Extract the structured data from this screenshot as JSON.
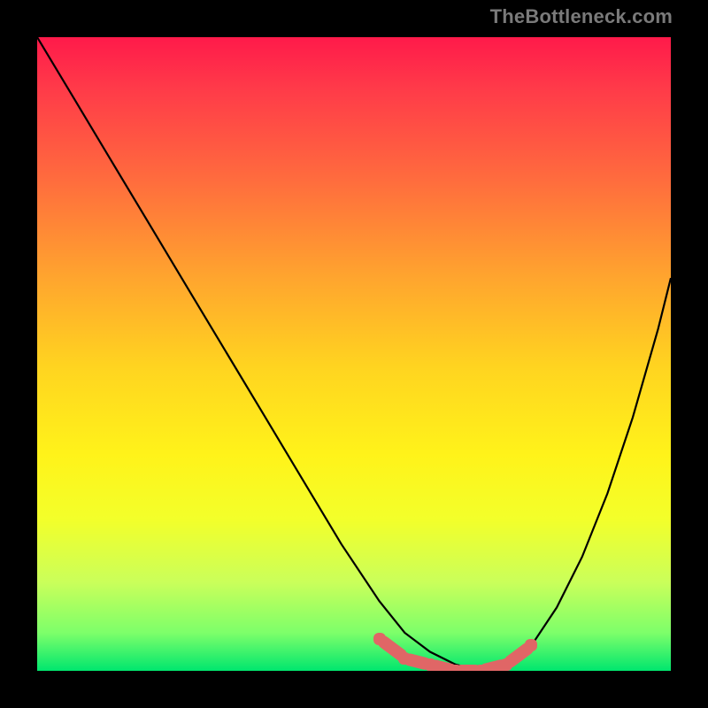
{
  "watermark": "TheBottleneck.com",
  "accent_colors": {
    "marker": "#e06666",
    "curve": "#000000"
  },
  "chart_data": {
    "type": "line",
    "title": "",
    "xlabel": "",
    "ylabel": "",
    "xlim": [
      0,
      100
    ],
    "ylim": [
      0,
      100
    ],
    "grid": false,
    "series": [
      {
        "name": "bottleneck-curve",
        "x": [
          0,
          6,
          12,
          18,
          24,
          30,
          36,
          42,
          48,
          54,
          58,
          62,
          66,
          70,
          74,
          78,
          82,
          86,
          90,
          94,
          98,
          100
        ],
        "values": [
          100,
          90,
          80,
          70,
          60,
          50,
          40,
          30,
          20,
          11,
          6,
          3,
          1,
          0,
          1,
          4,
          10,
          18,
          28,
          40,
          54,
          62
        ]
      }
    ],
    "markers": {
      "name": "highlight-band",
      "x": [
        54,
        58,
        62,
        66,
        70,
        74,
        78
      ],
      "values": [
        5,
        2,
        1,
        0,
        0,
        1,
        4
      ]
    }
  }
}
